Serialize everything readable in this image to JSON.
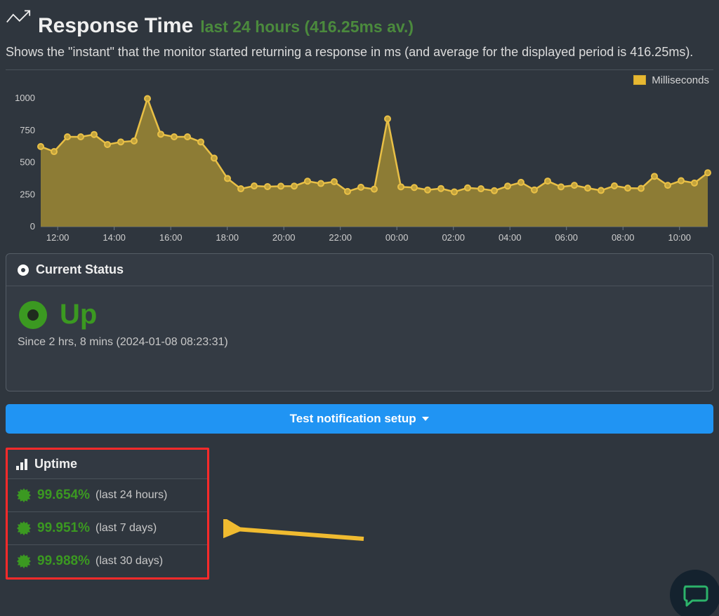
{
  "header": {
    "title": "Response Time",
    "subtitle": "last 24 hours  (416.25ms av.)",
    "description": "Shows the \"instant\" that the monitor started returning a response in ms (and average for the displayed period is 416.25ms)."
  },
  "legend": {
    "label": "Milliseconds"
  },
  "chart_data": {
    "type": "area",
    "title": "Response Time",
    "xlabel": "",
    "ylabel": "",
    "ylim": [
      0,
      1050
    ],
    "y_ticks": [
      0,
      250,
      500,
      750,
      1000
    ],
    "x_ticks": [
      "12:00",
      "14:00",
      "16:00",
      "18:00",
      "20:00",
      "22:00",
      "00:00",
      "02:00",
      "04:00",
      "06:00",
      "08:00",
      "10:00"
    ],
    "series": [
      {
        "name": "Milliseconds",
        "values": [
          624,
          585,
          700,
          700,
          718,
          640,
          660,
          668,
          998,
          720,
          700,
          700,
          660,
          534,
          375,
          295,
          317,
          312,
          315,
          316,
          354,
          336,
          350,
          274,
          307,
          292,
          840,
          310,
          305,
          286,
          297,
          271,
          302,
          295,
          280,
          316,
          345,
          286,
          355,
          310,
          322,
          300,
          282,
          318,
          300,
          298,
          392,
          322,
          358,
          340,
          420
        ]
      }
    ]
  },
  "status_panel": {
    "heading": "Current Status",
    "state_label": "Up",
    "since_text": "Since 2 hrs, 8 mins (2024-01-08 08:23:31)"
  },
  "test_button": {
    "label": "Test notification setup"
  },
  "uptime": {
    "heading": "Uptime",
    "rows": [
      {
        "value": "99.654%",
        "label": "(last 24 hours)"
      },
      {
        "value": "99.951%",
        "label": "(last 7 days)"
      },
      {
        "value": "99.988%",
        "label": "(last 30 days)"
      }
    ]
  }
}
